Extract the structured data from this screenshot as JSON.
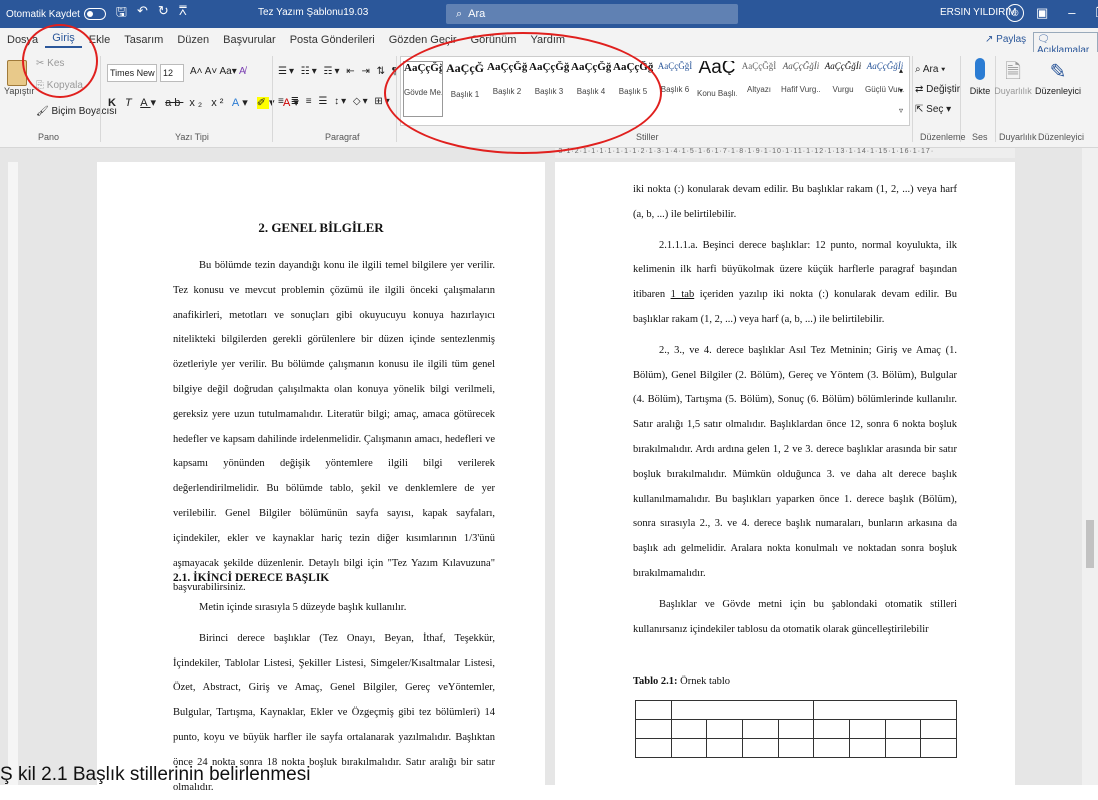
{
  "titlebar": {
    "autosave_label": "Otomatik Kaydet",
    "document_title": "Tez Yazım Şablonu19.03",
    "search_placeholder": "Ara",
    "user_name": "ERSIN YILDIRIM"
  },
  "ribbon_tabs": [
    "Dosya",
    "Giriş",
    "Ekle",
    "Tasarım",
    "Düzen",
    "Başvurular",
    "Posta Gönderileri",
    "Gözden Geçir",
    "Görünüm",
    "Yardım"
  ],
  "share_label": "Paylaş",
  "comments_label": "Açıklamalar",
  "ribbon": {
    "paste_label": "Yapıştır",
    "cut_label": "Kes",
    "copy_label": "Kopyala",
    "format_painter_label": "Biçim Boyacısı",
    "font_name": "Times New Ror",
    "font_size": "12",
    "group_clipboard": "Pano",
    "group_font": "Yazı Tipi",
    "group_paragraph": "Paragraf",
    "group_styles": "Stiller",
    "group_editing": "Düzenleme",
    "group_voice": "Ses",
    "group_sensitivity": "Duyarlılık",
    "group_editor": "Düzenleyici",
    "find_label": "Ara",
    "replace_label": "Değiştir",
    "select_label": "Seç",
    "dictate_label": "Dikte",
    "sensitivity_label": "Duyarlılık",
    "editor_label": "Düzenleyici",
    "styles": [
      {
        "sample": "AaÇçĞğİ",
        "name": "Gövde Me..."
      },
      {
        "sample": "AaÇçĞ",
        "name": "Başlık 1"
      },
      {
        "sample": "AaÇçĞğ",
        "name": "Başlık 2"
      },
      {
        "sample": "AaÇçĞğ",
        "name": "Başlık 3"
      },
      {
        "sample": "AaÇçĞğ",
        "name": "Başlık 4"
      },
      {
        "sample": "AaÇçĞğİ",
        "name": "Başlık 5"
      },
      {
        "sample": "AaÇçĞğİ",
        "name": "Başlık 6"
      },
      {
        "sample": "AaÇ",
        "name": "Konu Başlı..."
      },
      {
        "sample": "AaÇçĞğİ",
        "name": "Altyazı"
      },
      {
        "sample": "AaÇçĞğİi",
        "name": "Hafif Vurg..."
      },
      {
        "sample": "AaÇçĞğİi",
        "name": "Vurgu"
      },
      {
        "sample": "AaÇçĞğİi",
        "name": "Güçlü Vur..."
      }
    ]
  },
  "page1": {
    "heading": "2. GENEL BİLGİLER",
    "para1": "Bu bölümde tezin dayandığı konu ile ilgili temel bilgilere yer verilir. Tez konusu ve mevcut problemin çözümü ile ilgili önceki çalışmaların anafikirleri, metotları ve sonuçları gibi okuyucuyu konuya hazırlayıcı nitelikteki bilgilerden gerekli görülenlere bir düzen içinde sentezlenmiş özetleriyle yer verilir. Bu bölümde çalışmanın konusu ile ilgili tüm genel bilgiye değil doğrudan çalışılmakta olan konuya yönelik bilgi verilmeli, gereksiz yere uzun tutulmamalıdır. Literatür bilgi; amaç, amaca götürecek hedefler ve kapsam dahilinde irdelenmelidir. Çalışmanın amacı, hedefleri ve kapsamı yönünden değişik yöntemlere ilgili bilgi verilerek değerlendirilmelidir. Bu bölümde tablo, şekil ve denklemlere de yer verilebilir. Genel Bilgiler bölümünün sayfa sayısı, kapak sayfaları, içindekiler, ekler ve kaynaklar hariç tezin diğer kısımlarının 1/3'ünü aşmayacak şekilde düzenlenir. Detaylı bilgi için \"Tez Yazım Kılavuzuna\" başvurabilirsiniz.",
    "subheading": "2.1. İKİNCİ DERECE BAŞLIK",
    "para2": "Metin içinde sırasıyla 5 düzeyde başlık kullanılır.",
    "para3": "Birinci derece başlıklar (Tez Onayı, Beyan, İthaf, Teşekkür, İçindekiler, Tablolar Listesi, Şekiller Listesi, Simgeler/Kısaltmalar Listesi, Özet, Abstract, Giriş ve Amaç, Genel Bilgiler, Gereç veYöntemler, Bulgular, Tartışma, Kaynaklar, Ekler ve Özgeçmiş gibi tez bölümleri) 14 punto, koyu ve büyük harfler ile sayfa ortalanarak yazılmalıdır. Başlıktan önce 24 nokta sonra 18 nokta boşluk bırakılmalıdır. Satır aralığı bir satır olmalıdır."
  },
  "page2": {
    "para1": "iki nokta (:) konularak devam edilir. Bu başlıklar rakam (1, 2, ...) veya harf (a, b, ...) ile belirtilebilir.",
    "para2a": "2.1.1.1.a. Beşinci derece başlıklar: 12 punto, normal koyulukta, ilk kelimenin ilk harfi büyükolmak üzere küçük harflerle paragraf başından itibaren ",
    "para2_link": "1 tab",
    "para2b": " içeriden yazılıp iki nokta (:) konularak devam edilir. Bu başlıklar rakam (1, 2, ...) veya harf (a, b, ...) ile belirtilebilir.",
    "para3": "2., 3., ve 4. derece başlıklar Asıl Tez Metninin; Giriş ve Amaç (1. Bölüm), Genel Bilgiler (2. Bölüm), Gereç ve Yöntem (3. Bölüm), Bulgular (4. Bölüm), Tartışma (5. Bölüm), Sonuç (6. Bölüm) bölümlerinde kullanılır. Satır aralığı 1,5 satır olmalıdır. Başlıklardan önce 12, sonra 6 nokta boşluk bırakılmalıdır. Ardı ardına gelen 1, 2 ve 3. derece başlıklar arasında bir satır boşluk bırakılmalıdır. Mümkün olduğunca 3. ve daha alt derece başlık kullanılmamalıdır. Bu başlıkları yaparken önce 1. derece başlık (Bölüm), sonra sırasıyla 2., 3. ve 4. derece başlık numaraları, bunların arkasına da başlık adı gelmelidir. Aralara nokta konulmalı ve noktadan sonra boşluk bırakılmamalıdır.",
    "para4": "Başlıklar ve Gövde metni için bu şablondaki otomatik stilleri kullanırsanız içindekiler tablosu da otomatik olarak güncelleştirilebilir",
    "table_caption_bold": "Tablo 2.1:",
    "table_caption_rest": " Örnek tablo"
  },
  "bottom_caption": "Ş kil 2.1 Başlık stillerinin belirlenmesi",
  "colors": {
    "titlebar": "#2b579a",
    "highlight": "#e0201e"
  }
}
